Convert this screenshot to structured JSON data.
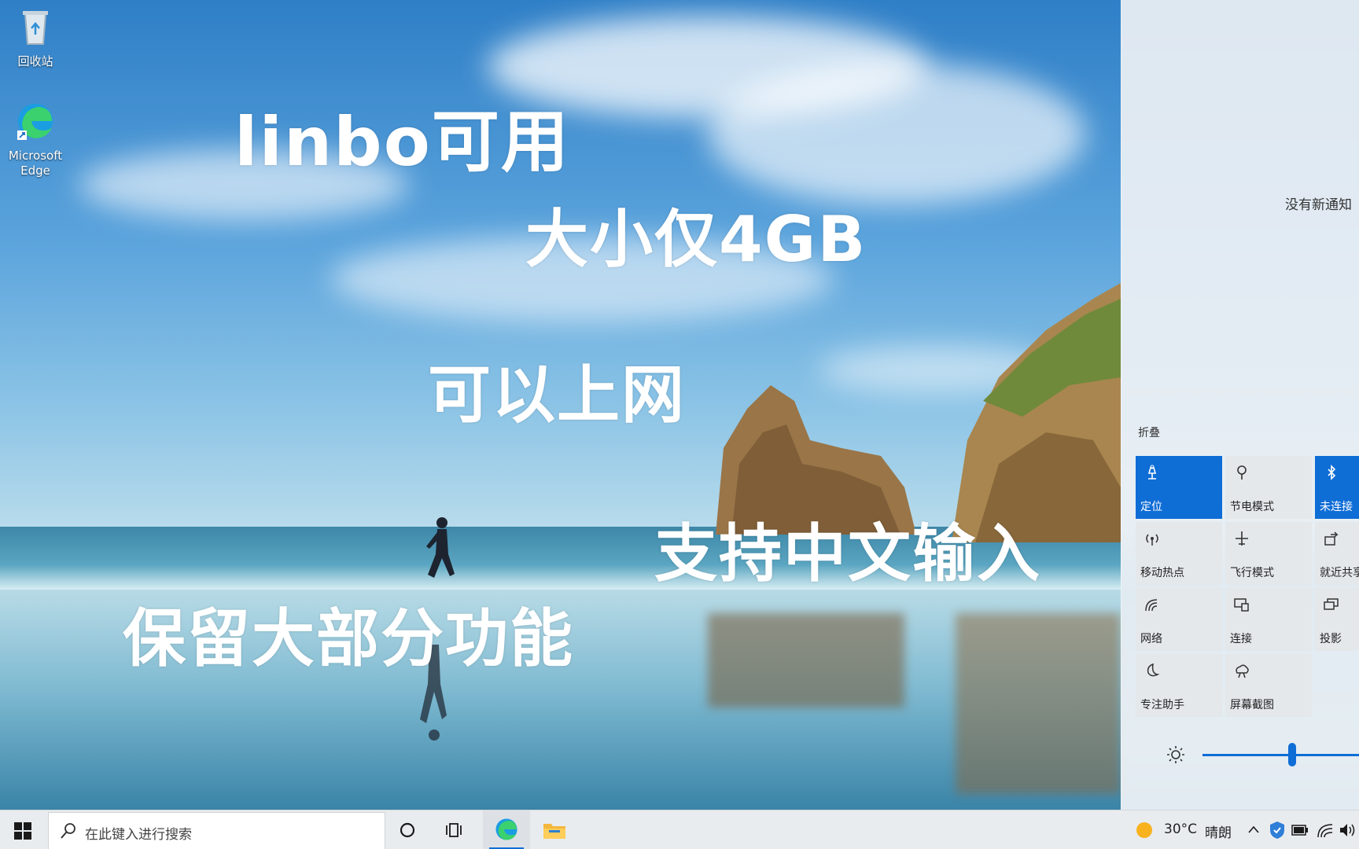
{
  "desktop": {
    "icons": [
      {
        "name": "recycle-bin",
        "label": "回收站"
      },
      {
        "name": "microsoft-edge",
        "label": "Microsoft Edge"
      }
    ]
  },
  "overlay_text": {
    "line1": "linbo可用",
    "line2": "大小仅4GB",
    "line3": "可以上网",
    "line4": "支持中文输入",
    "line5": "保留大部分功能"
  },
  "action_center": {
    "no_notifications": "没有新通知",
    "collapse": "折叠",
    "tiles": [
      {
        "label": "定位",
        "icon": "location-icon",
        "active": true
      },
      {
        "label": "节电模式",
        "icon": "battery-saver-icon",
        "active": false
      },
      {
        "label": "未连接",
        "icon": "bluetooth-icon",
        "active": true
      },
      {
        "label": "移动热点",
        "icon": "hotspot-icon",
        "active": false
      },
      {
        "label": "飞行模式",
        "icon": "airplane-icon",
        "active": false
      },
      {
        "label": "就近共享",
        "icon": "nearby-share-icon",
        "active": false
      },
      {
        "label": "网络",
        "icon": "network-icon",
        "active": false
      },
      {
        "label": "连接",
        "icon": "connect-icon",
        "active": false
      },
      {
        "label": "投影",
        "icon": "project-icon",
        "active": false
      },
      {
        "label": "专注助手",
        "icon": "focus-assist-icon",
        "active": false
      },
      {
        "label": "屏幕截图",
        "icon": "screen-snip-icon",
        "active": false
      }
    ],
    "brightness_level": 0.57
  },
  "taskbar": {
    "search_placeholder": "在此键入进行搜索",
    "weather": {
      "temp": "30°C",
      "condition": "晴朗"
    },
    "accent": "#0f6dd6"
  }
}
